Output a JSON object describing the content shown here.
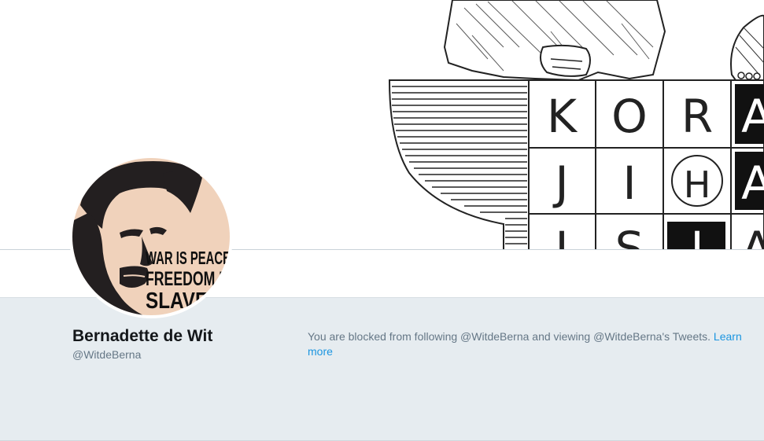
{
  "profile": {
    "name": "Bernadette de Wit",
    "handle": "@WitdeBerna"
  },
  "avatar": {
    "poster_lines": [
      "WAR IS PEACE",
      "FREEDOM IS",
      "SLAVERY"
    ]
  },
  "banner": {
    "grid_letters": [
      "K",
      "O",
      "R",
      "A",
      "J",
      "I",
      "H",
      "A",
      "I",
      "S",
      "I",
      "A"
    ]
  },
  "blocked_notice": {
    "text": "You are blocked from following @WitdeBerna and viewing @WitdeBerna's Tweets. ",
    "link_label": "Learn more"
  },
  "colors": {
    "background": "#e6ecf0",
    "link": "#1b95e0",
    "secondary_text": "#657786",
    "primary_text": "#14171a"
  }
}
